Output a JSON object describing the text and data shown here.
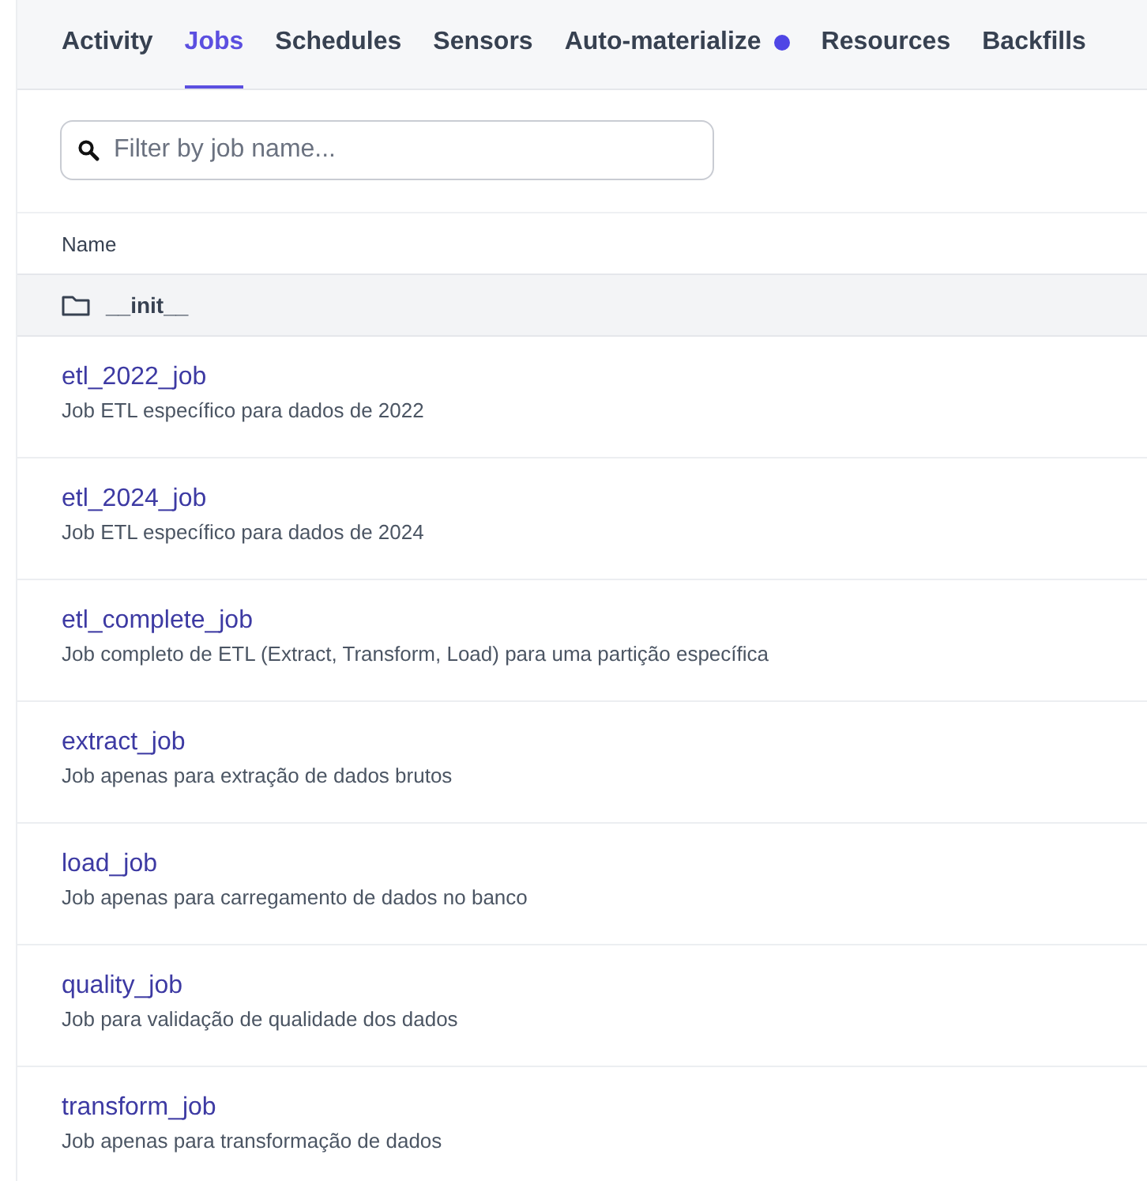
{
  "tabs": [
    {
      "label": "Activity",
      "selected": false,
      "indicator": false
    },
    {
      "label": "Jobs",
      "selected": true,
      "indicator": false
    },
    {
      "label": "Schedules",
      "selected": false,
      "indicator": false
    },
    {
      "label": "Sensors",
      "selected": false,
      "indicator": false
    },
    {
      "label": "Auto-materialize",
      "selected": false,
      "indicator": true
    },
    {
      "label": "Resources",
      "selected": false,
      "indicator": false
    },
    {
      "label": "Backfills",
      "selected": false,
      "indicator": false
    }
  ],
  "search": {
    "placeholder": "Filter by job name..."
  },
  "table": {
    "columns": [
      "Name"
    ],
    "folder": {
      "name": "__init__"
    },
    "rows": [
      {
        "name": "etl_2022_job",
        "description": "Job ETL específico para dados de 2022"
      },
      {
        "name": "etl_2024_job",
        "description": "Job ETL específico para dados de 2024"
      },
      {
        "name": "etl_complete_job",
        "description": "Job completo de ETL (Extract, Transform, Load) para uma partição específica"
      },
      {
        "name": "extract_job",
        "description": "Job apenas para extração de dados brutos"
      },
      {
        "name": "load_job",
        "description": "Job apenas para carregamento de dados no banco"
      },
      {
        "name": "quality_job",
        "description": "Job para validação de qualidade dos dados"
      },
      {
        "name": "transform_job",
        "description": "Job apenas para transformação de dados"
      }
    ]
  }
}
